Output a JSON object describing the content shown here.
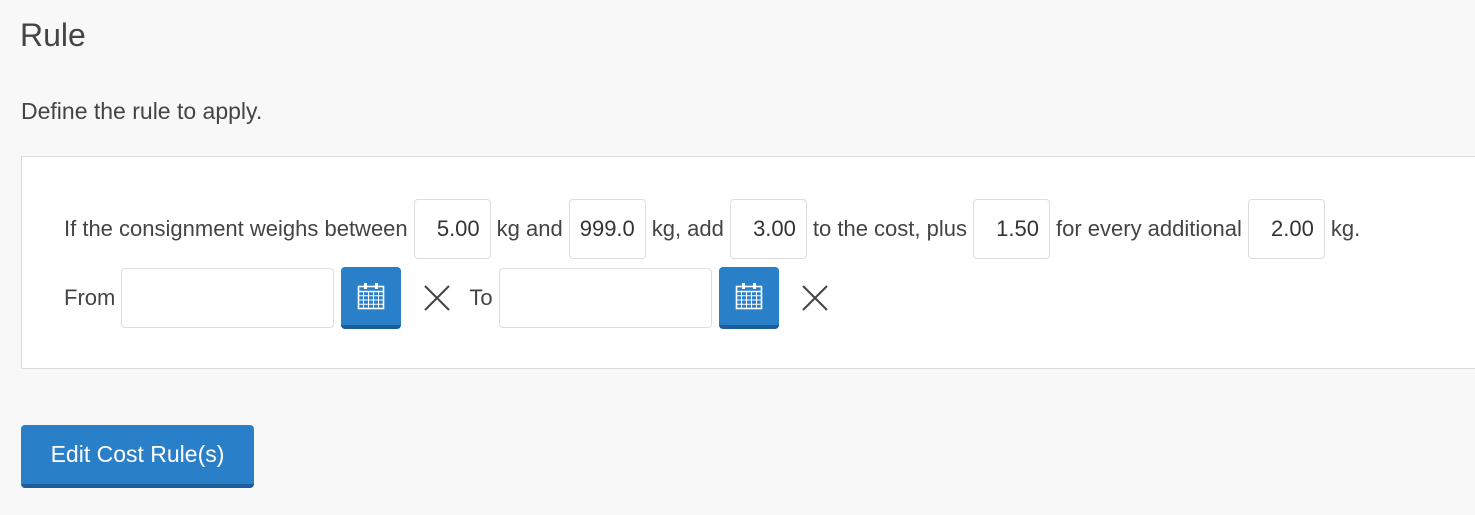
{
  "page": {
    "title": "Rule",
    "description": "Define the rule to apply."
  },
  "rule": {
    "text_if": "If the consignment weighs between",
    "min_weight": "5.00",
    "text_kg_and": "kg and",
    "max_weight": "999.0",
    "text_kg_add": "kg, add",
    "base_cost": "3.00",
    "text_to_cost_plus": "to the cost, plus",
    "additional_cost": "1.50",
    "text_for_every": "for every additional",
    "additional_weight": "2.00",
    "text_kg_end": "kg.",
    "from_label": "From",
    "from_value": "",
    "to_label": "To",
    "to_value": ""
  },
  "icons": {
    "calendar": "calendar-icon",
    "clear": "close-icon"
  },
  "colors": {
    "accent": "#2a7fc9",
    "accent_dark": "#1b5d99"
  },
  "actions": {
    "edit_label": "Edit Cost Rule(s)"
  }
}
